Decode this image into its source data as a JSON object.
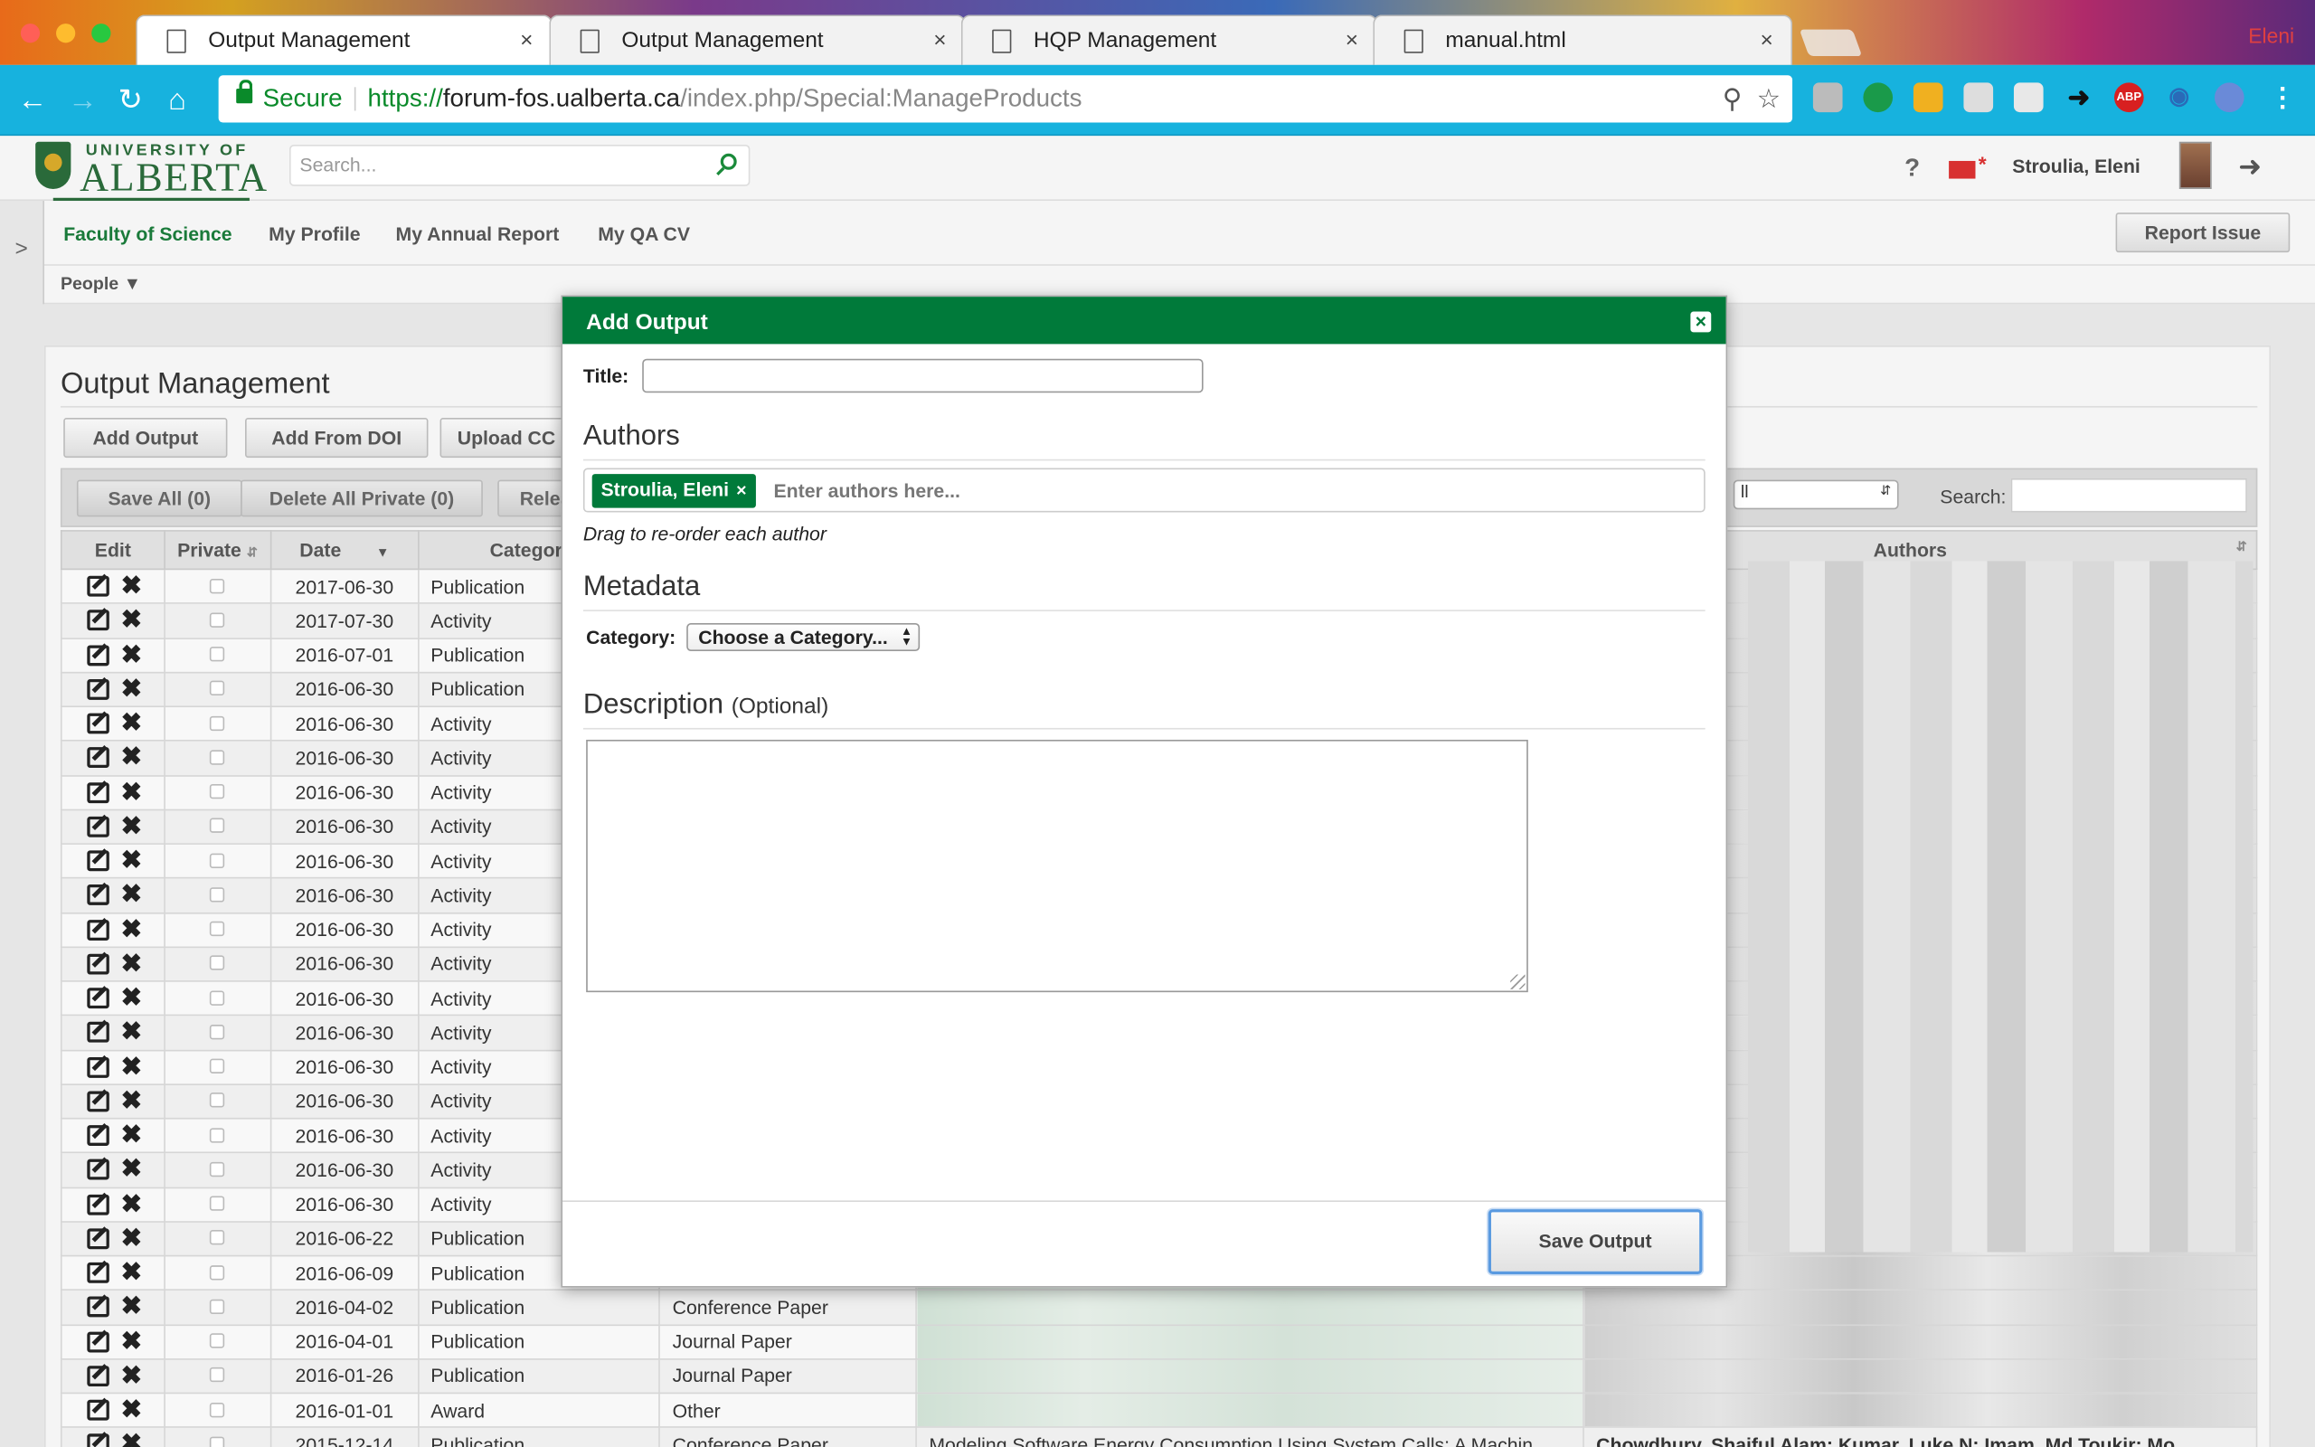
{
  "browser": {
    "tabs": [
      {
        "label": "Output Management",
        "close": "×"
      },
      {
        "label": "Output Management",
        "close": "×"
      },
      {
        "label": "HQP Management",
        "close": "×"
      },
      {
        "label": "manual.html",
        "close": "×"
      }
    ],
    "profile_name": "Eleni",
    "secure_label": "Secure",
    "url_scheme": "https://",
    "url_host": "forum-fos.ualberta.ca",
    "url_path": "/index.php/Special:ManageProducts"
  },
  "header": {
    "logo_top": "UNIVERSITY OF",
    "logo_main": "ALBERTA",
    "search_placeholder": "Search...",
    "help": "?",
    "user_name": "Stroulia, Eleni"
  },
  "nav": {
    "toggle": ">",
    "items": [
      "Faculty of Science",
      "My Profile",
      "My Annual Report",
      "My QA CV"
    ],
    "report_issue": "Report Issue",
    "people": "People ▼"
  },
  "page": {
    "title": "Output Management",
    "buttons": [
      "Add Output",
      "Add From DOI",
      "Upload CC"
    ],
    "table_toolbar": {
      "save_all": "Save All (0)",
      "delete_private": "Delete All Private (0)",
      "release": "Relea",
      "filter_value": "ll",
      "search_label": "Search:"
    },
    "columns": [
      "Edit",
      "Private",
      "Date",
      "Category",
      "Authors"
    ],
    "rows": [
      {
        "date": "2017-06-30",
        "category": "Publication",
        "type": ""
      },
      {
        "date": "2017-07-30",
        "category": "Activity",
        "type": ""
      },
      {
        "date": "2016-07-01",
        "category": "Publication",
        "type": ""
      },
      {
        "date": "2016-06-30",
        "category": "Publication",
        "type": ""
      },
      {
        "date": "2016-06-30",
        "category": "Activity",
        "type": ""
      },
      {
        "date": "2016-06-30",
        "category": "Activity",
        "type": ""
      },
      {
        "date": "2016-06-30",
        "category": "Activity",
        "type": ""
      },
      {
        "date": "2016-06-30",
        "category": "Activity",
        "type": ""
      },
      {
        "date": "2016-06-30",
        "category": "Activity",
        "type": ""
      },
      {
        "date": "2016-06-30",
        "category": "Activity",
        "type": ""
      },
      {
        "date": "2016-06-30",
        "category": "Activity",
        "type": ""
      },
      {
        "date": "2016-06-30",
        "category": "Activity",
        "type": ""
      },
      {
        "date": "2016-06-30",
        "category": "Activity",
        "type": ""
      },
      {
        "date": "2016-06-30",
        "category": "Activity",
        "type": ""
      },
      {
        "date": "2016-06-30",
        "category": "Activity",
        "type": ""
      },
      {
        "date": "2016-06-30",
        "category": "Activity",
        "type": ""
      },
      {
        "date": "2016-06-30",
        "category": "Activity",
        "type": ""
      },
      {
        "date": "2016-06-30",
        "category": "Activity",
        "type": ""
      },
      {
        "date": "2016-06-30",
        "category": "Activity",
        "type": ""
      },
      {
        "date": "2016-06-22",
        "category": "Publication",
        "type": ""
      },
      {
        "date": "2016-06-09",
        "category": "Publication",
        "type": ""
      },
      {
        "date": "2016-04-02",
        "category": "Publication",
        "type": "Conference Paper"
      },
      {
        "date": "2016-04-01",
        "category": "Publication",
        "type": "Journal Paper"
      },
      {
        "date": "2016-01-26",
        "category": "Publication",
        "type": "Journal Paper"
      },
      {
        "date": "2016-01-01",
        "category": "Award",
        "type": "Other"
      },
      {
        "date": "2015-12-14",
        "category": "Publication",
        "type": "Conference Paper"
      }
    ],
    "last_row_title": "Modeling Software Energy Consumption Using System Calls: A Machin",
    "last_row_authors": "Chowdhury, Shaiful Alam; Kumar, Luke N; Imam, Md Toukir; Mo"
  },
  "dialog": {
    "title": "Add Output",
    "close": "×",
    "title_label": "Title:",
    "authors_heading": "Authors",
    "author_chip": "Stroulia, Eleni",
    "author_chip_remove": "×",
    "authors_placeholder": "Enter authors here...",
    "drag_hint": "Drag to re-order each author",
    "metadata_heading": "Metadata",
    "category_label": "Category:",
    "category_value": "Choose a Category...",
    "description_heading": "Description",
    "description_optional": "(Optional)",
    "save_button": "Save Output"
  },
  "colors": {
    "brand_green": "#007a3a",
    "toolbar_blue": "#17b2de"
  }
}
